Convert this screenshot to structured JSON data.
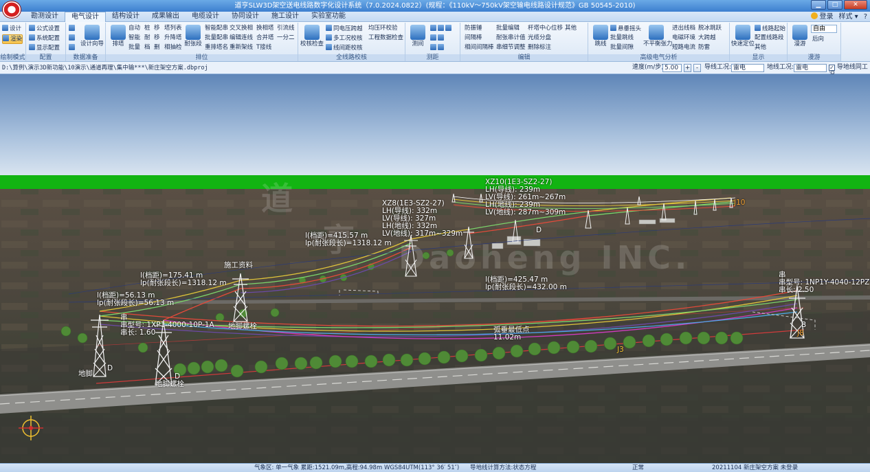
{
  "window": {
    "title": "道亨SLW3D架空送电线路数字化设计系统（7.0.2024.0822）(规程：《110kV～750kV架空输电线路设计规范》GB 50545-2010)",
    "min": "▁",
    "max": "□",
    "close": "✕"
  },
  "tabs": [
    "勘测设计",
    "电气设计",
    "结构设计",
    "成果输出",
    "电缆设计",
    "协同设计",
    "施工设计",
    "实验室功能"
  ],
  "tabs_right": {
    "login": "登录",
    "style": "样式",
    "style_arrow": "▾",
    "help": "?"
  },
  "ribbon": {
    "g1": {
      "label": "绘制模式",
      "items": [
        "设计",
        "渲染"
      ]
    },
    "g2": {
      "label": "配置",
      "items": [
        "公式设置",
        "系统配置",
        "显示配置"
      ]
    },
    "g3": {
      "label": "数据准备",
      "items": [
        "设计向导"
      ]
    },
    "g4": {
      "label": "排位",
      "big": [
        "排塔",
        "耐张段"
      ],
      "col1": [
        "自动",
        "智能",
        "批量"
      ],
      "col2": [
        "桩",
        "耐",
        "档"
      ],
      "col3": [
        "移",
        "移",
        "删"
      ],
      "col4": [
        "塔列表",
        "升降塔",
        "相抽检"
      ],
      "col5": [
        "智能配串",
        "批量配串",
        "重排塔名"
      ],
      "col6": [
        "交叉换相",
        "编辑连线",
        "重新架线"
      ],
      "col7": [
        "换相塔",
        "合并塔",
        "T接线"
      ],
      "col8": [
        "引流线",
        "一分二"
      ]
    },
    "g5": {
      "label": "全线路校核",
      "big": [
        "校核检查"
      ],
      "items": [
        "同电压跨越",
        "多工况校核",
        "线间距校核",
        "均压环校验",
        "工程数据检查"
      ]
    },
    "g6": {
      "label": "测距",
      "big": [
        "测间"
      ]
    },
    "g7": {
      "label": "编辑",
      "col1": [
        "防振锤",
        "间隔棒",
        "相间间隔棒"
      ],
      "col2": [
        "批量编辑",
        "耐张串计值",
        "串细节调整"
      ],
      "col3": [
        "杆塔中心位移",
        "光缆分盘",
        "删除标注"
      ],
      "other": "其他"
    },
    "g8": {
      "label": "高级电气分析",
      "items": [
        "跳线",
        "悬垂摇头",
        "批量跳线",
        "批量间隙",
        "不平衡张力",
        "进出线档",
        "电磁环境",
        "短路电流",
        "脱冰跳跃",
        "大跨越",
        "防雷"
      ]
    },
    "g9": {
      "label": "显示",
      "items": [
        "快速定位",
        "线路起始",
        "配置线路段",
        "其他"
      ]
    },
    "g10": {
      "label": "漫游",
      "big": [
        "漫游"
      ],
      "mode": "自由",
      "back": "后向"
    }
  },
  "pathbar": {
    "path": "D:\\算例\\演示3D新功能\\10演示\\通道再理\\集中输***\\新庄架空方案.dbproj",
    "speed_label": "速度(m/步):",
    "speed_value": "5.00",
    "plus": "+",
    "minus": "-",
    "cond_label": "导线工况:",
    "cond_value": "雷电",
    "earth_label": "地线工况:",
    "earth_value": "雷电",
    "checkbox_label": "导地线同工况",
    "checkbox_mark": "✓"
  },
  "scene": {
    "watermark_a": "道",
    "watermark_b": "亨",
    "watermark_c": "Daoheng INC.",
    "ann_xz10": [
      "XZ10(1E3-SZ2-27)",
      "LH(导线): 239m",
      "LV(导线): 261m~267m",
      "LH(地线): 239m",
      "LV(地线): 287m~309m"
    ],
    "ann_xz8": [
      "XZ8(1E3-SZ2-27)",
      "LH(导线): 332m",
      "LV(导线): 327m",
      "LH(地线): 332m",
      "LV(地线): 317m~329m"
    ],
    "ann_span3": [
      "l(档距)=415.57 m",
      "lp(耐张段长)=1318.12 m"
    ],
    "ann_span2": [
      "l(档距)=175.41 m",
      "lp(耐张段长)=1318.12 m"
    ],
    "ann_span1": [
      "l(档距)=56.13 m",
      "lp(耐张段长)=56.13 m"
    ],
    "ann_span4": [
      "l(档距)=425.47 m",
      "lp(耐张段长)=432.00 m"
    ],
    "construction": "施工资料",
    "string_left": [
      "串",
      "串型号: 1XP1-4000-10P-1A",
      "串长: 1.60"
    ],
    "string_right": [
      "串",
      "串型号: 1NP1Y-4040-12PZ",
      "串长: 2.50"
    ],
    "lowest_point": [
      "弧垂最低点",
      "11.02m"
    ],
    "tower_tag_left": "地脚",
    "tower_tag_mid": "地脚螺栓",
    "tower_tag_front": "地脚螺栓",
    "tag_d": "D",
    "tag_b": "B",
    "tag_j3": "J3",
    "tag_j8": "J8",
    "tag_j10": "J10"
  },
  "status": {
    "weather": "气象区: 单一气象 累距:1521.09m,高程:94.98m WGS84UTM(113° 36′ 51″)",
    "method": "导地线计算方法:状态方程",
    "state": "正常",
    "project": "20211104 新庄架空方案 未登录"
  }
}
